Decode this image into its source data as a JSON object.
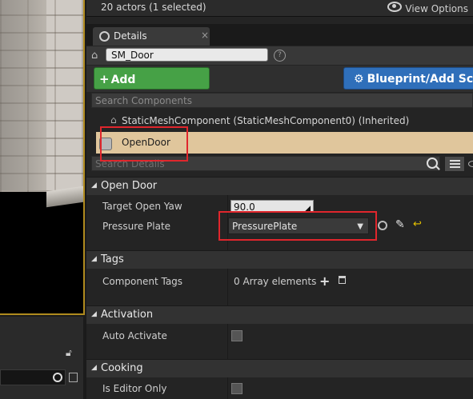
{
  "toolbar": {
    "actors_count": "20 actors (1 selected)",
    "view_options": "View Options"
  },
  "tab": {
    "label": "Details",
    "close": "×"
  },
  "actor": {
    "name": "SM_Door",
    "help": "?"
  },
  "buttons": {
    "add_component": "Add Component",
    "blueprint": "Blueprint/Add Script"
  },
  "search": {
    "components_placeholder": "Search Components",
    "details_placeholder": "Search Details"
  },
  "components": [
    {
      "label": "StaticMeshComponent (StaticMeshComponent0) (Inherited)"
    },
    {
      "label": "OpenDoor"
    }
  ],
  "categories": {
    "open_door": {
      "title": "Open Door",
      "props": {
        "target_open_yaw": {
          "label": "Target Open Yaw",
          "value": "90.0"
        },
        "pressure_plate": {
          "label": "Pressure Plate",
          "value": "PressurePlate"
        }
      }
    },
    "tags": {
      "title": "Tags",
      "component_tags": {
        "label": "Component Tags",
        "value": "0 Array elements"
      }
    },
    "activation": {
      "title": "Activation",
      "auto_activate": {
        "label": "Auto Activate",
        "checked": false
      }
    },
    "cooking": {
      "title": "Cooking",
      "is_editor_only": {
        "label": "Is Editor Only",
        "checked": false
      }
    }
  },
  "icons": [
    "eye-icon",
    "search-icon",
    "close-icon",
    "actor-icon",
    "help-icon",
    "plus-icon",
    "gear-icon",
    "hierarchy-icon",
    "component-icon",
    "magnifier-icon",
    "view-list-icon",
    "find-icon",
    "eyedropper-icon",
    "reset-arrow-icon",
    "add-element-icon",
    "trash-icon",
    "lock-icon",
    "save-icon"
  ],
  "colors": {
    "accent_green": "#46a146",
    "accent_blue": "#2f6fba",
    "selection": "#e0c69c",
    "highlight_box": "#e0262c"
  }
}
